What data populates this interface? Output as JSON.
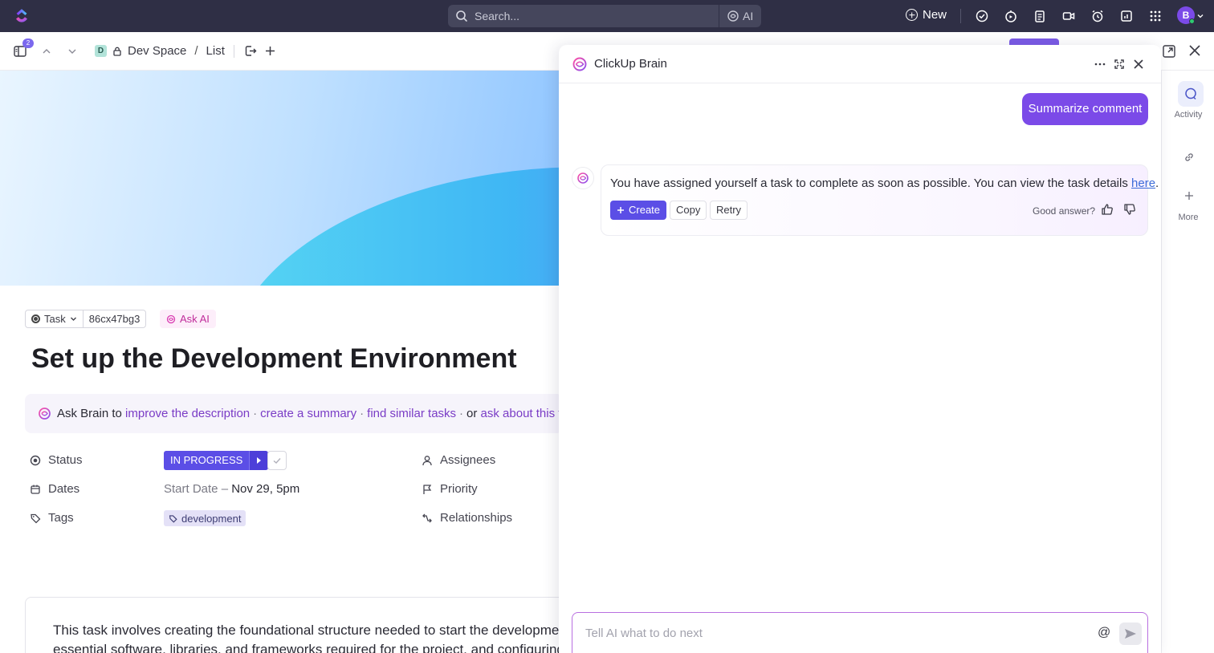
{
  "topbar": {
    "search_placeholder": "Search...",
    "ai_label": "AI",
    "new_label": "New",
    "avatar_initial": "B"
  },
  "subbar": {
    "sidebar_badge": "2",
    "space_chip": "D",
    "space_name": "Dev Space",
    "separator": "/",
    "list_name": "List"
  },
  "task": {
    "type_label": "Task",
    "id": "86cx47bg3",
    "ask_ai_label": "Ask AI",
    "title": "Set up the Development Environment",
    "ask_brain": {
      "prefix": "Ask Brain to",
      "improve": "improve the description",
      "summary": "create a summary",
      "similar": "find similar tasks",
      "or": "or",
      "ask": "ask about this task"
    },
    "fields": {
      "status_label": "Status",
      "status_value": "IN PROGRESS",
      "dates_label": "Dates",
      "start_date_label": "Start Date",
      "dates_dash": "–",
      "start_date_value": "Nov 29, 5pm",
      "tags_label": "Tags",
      "tag_value": "development",
      "assignees_label": "Assignees",
      "priority_label": "Priority",
      "relationships_label": "Relationships"
    },
    "description_line1": "This task involves creating the foundational structure needed to start the development p",
    "description_line2": "essential software, libraries, and frameworks required for the project, and configuring s"
  },
  "brain_panel": {
    "title": "ClickUp Brain",
    "user_message": "Summarize comment",
    "ai_message": "You have assigned yourself a task to complete as soon as possible. You can view the task details ",
    "ai_message_link": "here",
    "ai_message_end": ".",
    "create_label": "Create",
    "copy_label": "Copy",
    "retry_label": "Retry",
    "feedback_label": "Good answer?",
    "composer_placeholder": "Tell AI what to do next",
    "at_symbol": "@"
  },
  "rail": {
    "activity_label": "Activity",
    "more_label": "More"
  },
  "colors": {
    "topbar": "#2f2f45",
    "accent": "#7b4ae8",
    "status": "#5b4ee6"
  }
}
